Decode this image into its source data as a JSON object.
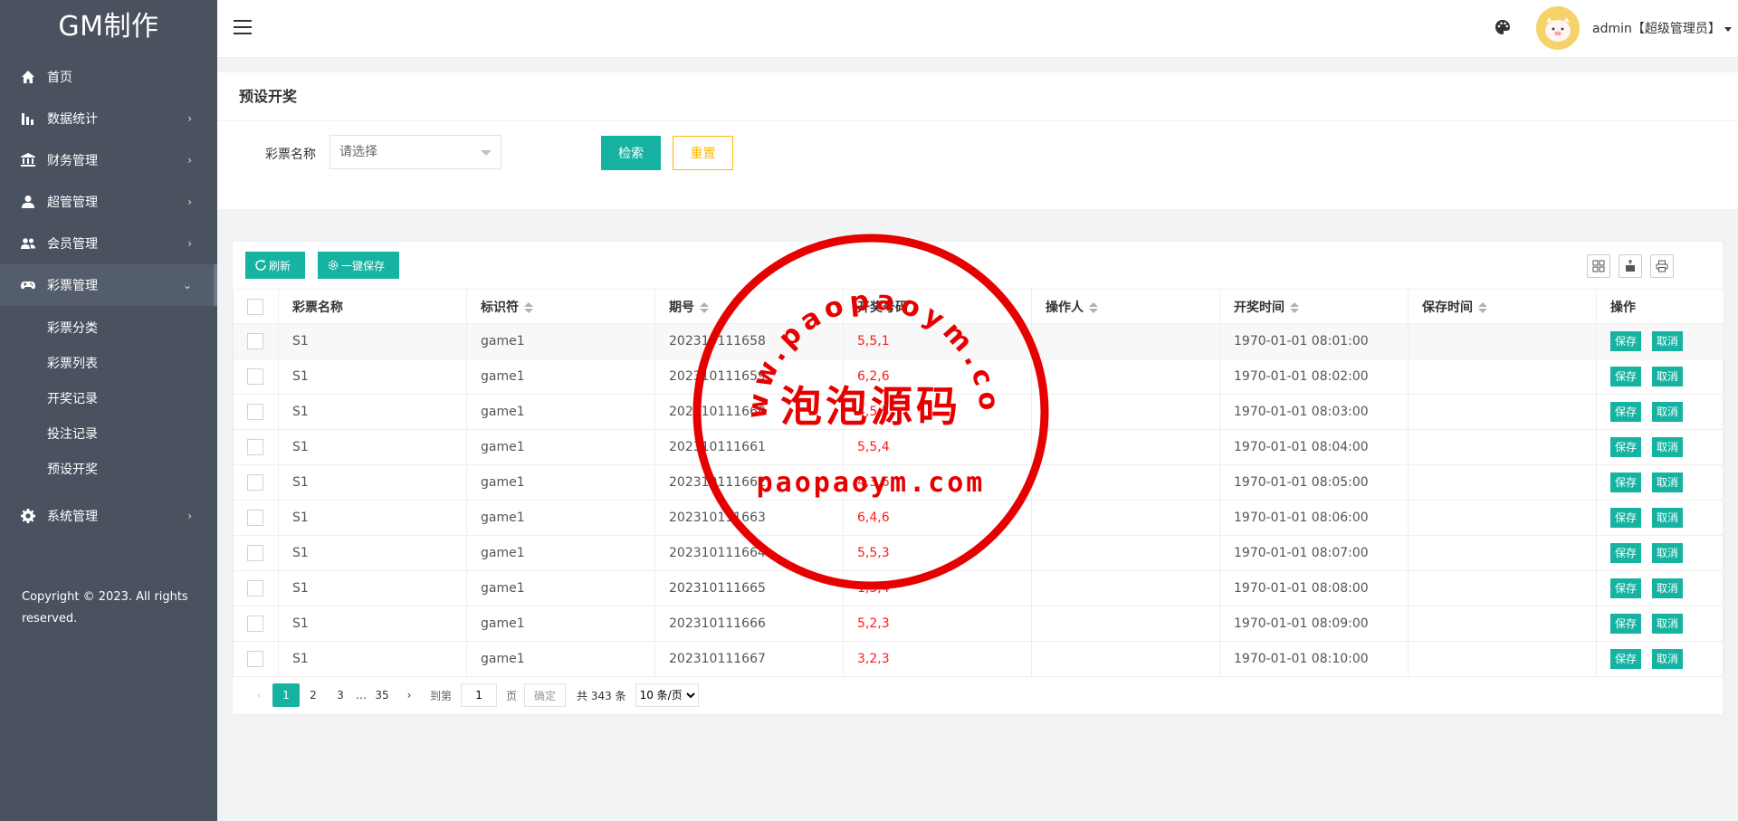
{
  "sidebar": {
    "logo": "GM制作",
    "items": [
      {
        "label": "首页",
        "icon": "home-icon",
        "has_children": false
      },
      {
        "label": "数据统计",
        "icon": "bar-chart-icon",
        "has_children": true
      },
      {
        "label": "财务管理",
        "icon": "bank-icon",
        "has_children": true
      },
      {
        "label": "超管管理",
        "icon": "user-icon",
        "has_children": true
      },
      {
        "label": "会员管理",
        "icon": "users-icon",
        "has_children": true
      },
      {
        "label": "彩票管理",
        "icon": "gamepad-icon",
        "has_children": true,
        "expanded": true
      },
      {
        "label": "系统管理",
        "icon": "gear-icon",
        "has_children": true
      }
    ],
    "subitems": [
      "彩票分类",
      "彩票列表",
      "开奖记录",
      "投注记录",
      "预设开奖"
    ],
    "copyright": "Copyright © 2023. All rights reserved."
  },
  "header": {
    "user": "admin【超级管理员】"
  },
  "search": {
    "title": "预设开奖",
    "label": "彩票名称",
    "placeholder": "请选择",
    "search_btn": "检索",
    "reset_btn": "重置"
  },
  "toolbar": {
    "refresh": "刷新",
    "save_all": "一键保存"
  },
  "table": {
    "columns": [
      "彩票名称",
      "标识符",
      "期号",
      "开奖号码",
      "操作人",
      "开奖时间",
      "保存时间",
      "操作"
    ],
    "rows": [
      {
        "name": "S1",
        "code": "game1",
        "issue": "202310111658",
        "numbers": "5,5,1",
        "operator": "",
        "open_time": "1970-01-01 08:01:00",
        "save_time": ""
      },
      {
        "name": "S1",
        "code": "game1",
        "issue": "202310111659",
        "numbers": "6,2,6",
        "operator": "",
        "open_time": "1970-01-01 08:02:00",
        "save_time": ""
      },
      {
        "name": "S1",
        "code": "game1",
        "issue": "202310111660",
        "numbers": "4,5,5",
        "operator": "",
        "open_time": "1970-01-01 08:03:00",
        "save_time": ""
      },
      {
        "name": "S1",
        "code": "game1",
        "issue": "202310111661",
        "numbers": "5,5,4",
        "operator": "",
        "open_time": "1970-01-01 08:04:00",
        "save_time": ""
      },
      {
        "name": "S1",
        "code": "game1",
        "issue": "202310111662",
        "numbers": "4,3,6",
        "operator": "",
        "open_time": "1970-01-01 08:05:00",
        "save_time": ""
      },
      {
        "name": "S1",
        "code": "game1",
        "issue": "202310111663",
        "numbers": "6,4,6",
        "operator": "",
        "open_time": "1970-01-01 08:06:00",
        "save_time": ""
      },
      {
        "name": "S1",
        "code": "game1",
        "issue": "202310111664",
        "numbers": "5,5,3",
        "operator": "",
        "open_time": "1970-01-01 08:07:00",
        "save_time": ""
      },
      {
        "name": "S1",
        "code": "game1",
        "issue": "202310111665",
        "numbers": "1,3,4",
        "operator": "",
        "open_time": "1970-01-01 08:08:00",
        "save_time": ""
      },
      {
        "name": "S1",
        "code": "game1",
        "issue": "202310111666",
        "numbers": "5,2,3",
        "operator": "",
        "open_time": "1970-01-01 08:09:00",
        "save_time": ""
      },
      {
        "name": "S1",
        "code": "game1",
        "issue": "202310111667",
        "numbers": "3,2,3",
        "operator": "",
        "open_time": "1970-01-01 08:10:00",
        "save_time": ""
      }
    ],
    "action_save": "保存",
    "action_cancel": "取消"
  },
  "pagination": {
    "pages": [
      "1",
      "2",
      "3"
    ],
    "ellipsis": "…",
    "last_page": "35",
    "current": "1",
    "goto_label": "到第",
    "goto_value": "1",
    "page_unit": "页",
    "confirm": "确定",
    "total": "共 343 条",
    "page_size": "10 条/页"
  },
  "watermark": {
    "top_text": "www.paopaoym.com",
    "center_text": "泡泡源码",
    "bottom_text": "paopaoym.com",
    "color": "#e60000"
  },
  "colors": {
    "sidebar_bg": "#4a5260",
    "primary": "#16b3a2",
    "warning": "#ffb800",
    "numbers": "#ff1a1a"
  }
}
